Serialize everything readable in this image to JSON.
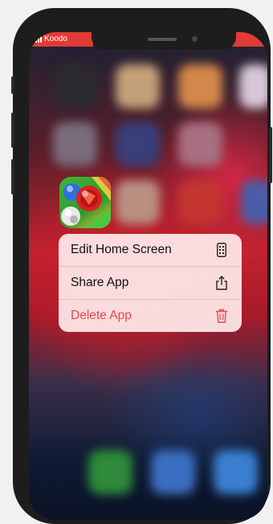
{
  "status_bar": {
    "carrier": "Koodo",
    "accent_color": "#e23a35"
  },
  "home_screen": {
    "app_icon": "marble-game-app-icon"
  },
  "context_menu": {
    "items": [
      {
        "label": "Edit Home Screen",
        "icon": "phone-apps-icon",
        "destructive": false
      },
      {
        "label": "Share App",
        "icon": "share-icon",
        "destructive": false
      },
      {
        "label": "Delete App",
        "icon": "trash-icon",
        "destructive": true
      }
    ],
    "destructive_color": "#e24a4a"
  }
}
